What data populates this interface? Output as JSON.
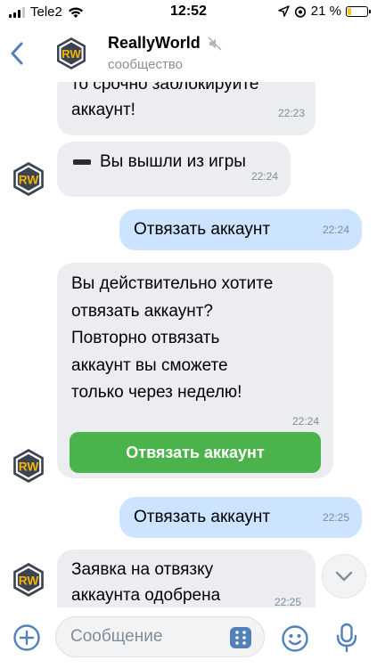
{
  "status_bar": {
    "carrier": "Tele2",
    "time": "12:52",
    "battery": "21 %",
    "battery_level": 0.21
  },
  "header": {
    "title": "ReallyWorld",
    "subtitle": "сообщество",
    "logo_text": "RW"
  },
  "messages": [
    {
      "direction": "in",
      "lines": [
        "то срочно заблокируйте",
        "аккаунт!"
      ],
      "time": "22:23"
    },
    {
      "direction": "in",
      "icon": "minus-icon",
      "text": "Вы вышли из игры",
      "time": "22:24"
    },
    {
      "direction": "out",
      "text": "Отвязать аккаунт",
      "time": "22:24"
    },
    {
      "direction": "in",
      "lines": [
        "Вы действительно хотите",
        "отвязать аккаунт?",
        "Повторно отвязать",
        "аккаунт вы сможете",
        "только через неделю!"
      ],
      "time": "22:24",
      "button": "Отвязать аккаунт"
    },
    {
      "direction": "out",
      "text": "Отвязать аккаунт",
      "time": "22:25"
    },
    {
      "direction": "in",
      "lines": [
        "Заявка на отвязку",
        "аккаунта одобрена"
      ],
      "time": "22:25"
    }
  ],
  "composer": {
    "placeholder": "Сообщение"
  },
  "colors": {
    "accent": "#5181b8",
    "incoming_bubble": "#ebedf0",
    "outgoing_bubble": "#cce4ff",
    "action_button": "#4bb34b"
  }
}
